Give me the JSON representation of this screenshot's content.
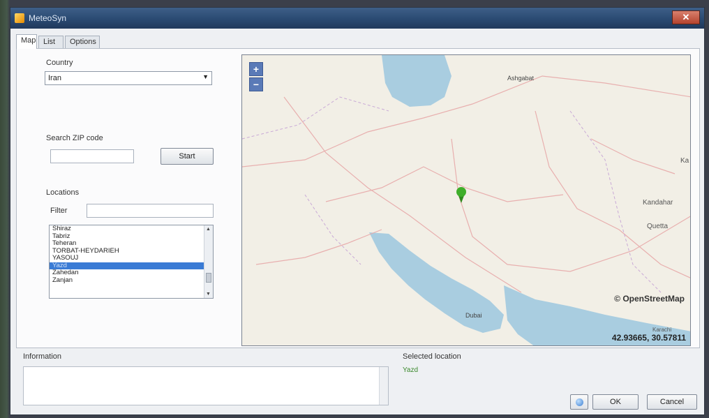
{
  "window": {
    "title": "MeteoSyn",
    "close_label": "✕"
  },
  "tabs": [
    {
      "label": "Map"
    },
    {
      "label": "List"
    },
    {
      "label": "Options"
    }
  ],
  "country": {
    "label": "Country",
    "value": "Iran"
  },
  "zip": {
    "label": "Search ZIP code",
    "value": "",
    "start_label": "Start"
  },
  "locations": {
    "label": "Locations",
    "filter_label": "Filter",
    "filter_value": "",
    "items": [
      "Shiraz",
      "Tabriz",
      "Teheran",
      "TORBAT-HEYDARIEH",
      "YASOUJ",
      "Yazd",
      "Zahedan",
      "Zanjan"
    ],
    "selected": "Yazd"
  },
  "map": {
    "zoom_in": "+",
    "zoom_out": "−",
    "attribution": "© OpenStreetMap",
    "coords": "42.93665, 30.57811",
    "labels": [
      "Ashgabat",
      "Kandahar",
      "Quetta",
      "Ka",
      "Dubai",
      "Karachi"
    ],
    "colors": {
      "land": "#f2efe6",
      "water": "#a9cde0",
      "pin": "#3fae2a"
    }
  },
  "info": {
    "label": "Information",
    "value": ""
  },
  "selected_location": {
    "label": "Selected location",
    "value": "Yazd"
  },
  "buttons": {
    "ok": "OK",
    "cancel": "Cancel",
    "globe_icon": "globe-icon"
  }
}
